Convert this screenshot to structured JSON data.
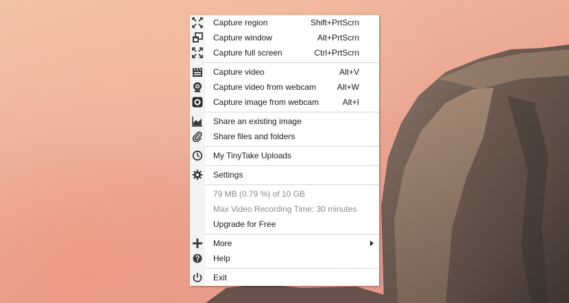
{
  "menu": {
    "items": [
      {
        "label": "Capture region",
        "shortcut": "Shift+PrtScrn",
        "icon": "capture-region-icon"
      },
      {
        "label": "Capture window",
        "shortcut": "Alt+PrtScrn",
        "icon": "capture-window-icon"
      },
      {
        "label": "Capture full screen",
        "shortcut": "Ctrl+PrtScrn",
        "icon": "fullscreen-icon"
      },
      {
        "label": "Capture video",
        "shortcut": "Alt+V",
        "icon": "film-clapper-icon"
      },
      {
        "label": "Capture video from webcam",
        "shortcut": "Alt+W",
        "icon": "webcam-icon"
      },
      {
        "label": "Capture image from webcam",
        "shortcut": "Alt+I",
        "icon": "camera-lens-icon"
      },
      {
        "label": "Share an existing image",
        "icon": "area-chart-icon"
      },
      {
        "label": "Share files and folders",
        "icon": "paperclip-icon"
      },
      {
        "label": "My TinyTake Uploads",
        "icon": "clock-icon"
      },
      {
        "label": "Settings",
        "icon": "gear-icon"
      },
      {
        "label": "79 MB (0.79 %) of 10 GB"
      },
      {
        "label": "Max Video Recording Time: 30 minutes"
      },
      {
        "label": "Upgrade for Free"
      },
      {
        "label": "More",
        "icon": "plus-icon"
      },
      {
        "label": "Help",
        "icon": "help-icon"
      },
      {
        "label": "Exit",
        "icon": "power-icon"
      }
    ]
  }
}
